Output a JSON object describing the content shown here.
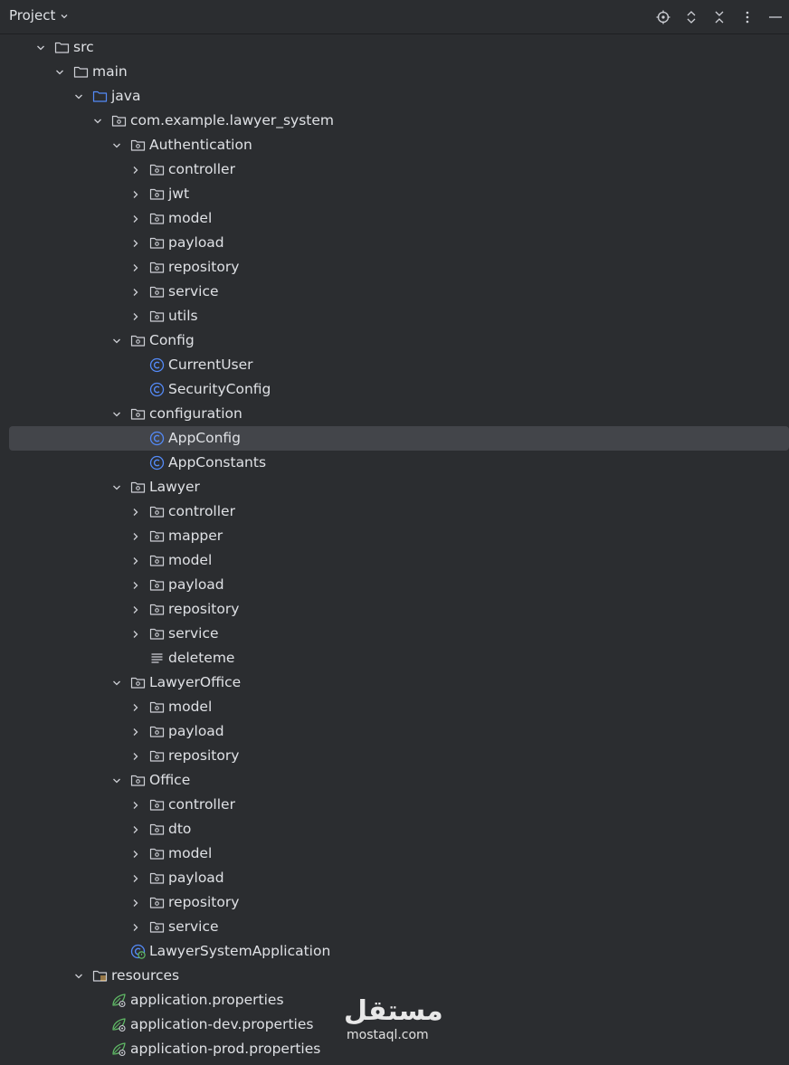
{
  "panel": {
    "title": "Project",
    "actions": [
      {
        "icon": "locate-icon"
      },
      {
        "icon": "expand-all-icon"
      },
      {
        "icon": "collapse-all-icon"
      },
      {
        "icon": "more-options-icon"
      },
      {
        "icon": "hide-panel-icon"
      }
    ]
  },
  "tree": [
    {
      "label": "src",
      "depth": 0,
      "expanded": true,
      "kind": "folder"
    },
    {
      "label": "main",
      "depth": 1,
      "expanded": true,
      "kind": "folder"
    },
    {
      "label": "java",
      "depth": 2,
      "expanded": true,
      "kind": "source-root"
    },
    {
      "label": "com.example.lawyer_system",
      "depth": 3,
      "expanded": true,
      "kind": "package"
    },
    {
      "label": "Authentication",
      "depth": 4,
      "expanded": true,
      "kind": "package"
    },
    {
      "label": "controller",
      "depth": 5,
      "expanded": false,
      "kind": "package"
    },
    {
      "label": "jwt",
      "depth": 5,
      "expanded": false,
      "kind": "package"
    },
    {
      "label": "model",
      "depth": 5,
      "expanded": false,
      "kind": "package"
    },
    {
      "label": "payload",
      "depth": 5,
      "expanded": false,
      "kind": "package"
    },
    {
      "label": "repository",
      "depth": 5,
      "expanded": false,
      "kind": "package"
    },
    {
      "label": "service",
      "depth": 5,
      "expanded": false,
      "kind": "package"
    },
    {
      "label": "utils",
      "depth": 5,
      "expanded": false,
      "kind": "package"
    },
    {
      "label": "Config",
      "depth": 4,
      "expanded": true,
      "kind": "package"
    },
    {
      "label": "CurrentUser",
      "depth": 5,
      "kind": "class"
    },
    {
      "label": "SecurityConfig",
      "depth": 5,
      "kind": "class"
    },
    {
      "label": "configuration",
      "depth": 4,
      "expanded": true,
      "kind": "package"
    },
    {
      "label": "AppConfig",
      "depth": 5,
      "kind": "class",
      "selected": true
    },
    {
      "label": "AppConstants",
      "depth": 5,
      "kind": "class"
    },
    {
      "label": "Lawyer",
      "depth": 4,
      "expanded": true,
      "kind": "package"
    },
    {
      "label": "controller",
      "depth": 5,
      "expanded": false,
      "kind": "package"
    },
    {
      "label": "mapper",
      "depth": 5,
      "expanded": false,
      "kind": "package"
    },
    {
      "label": "model",
      "depth": 5,
      "expanded": false,
      "kind": "package"
    },
    {
      "label": "payload",
      "depth": 5,
      "expanded": false,
      "kind": "package"
    },
    {
      "label": "repository",
      "depth": 5,
      "expanded": false,
      "kind": "package"
    },
    {
      "label": "service",
      "depth": 5,
      "expanded": false,
      "kind": "package"
    },
    {
      "label": "deleteme",
      "depth": 5,
      "kind": "text-file"
    },
    {
      "label": "LawyerOffice",
      "depth": 4,
      "expanded": true,
      "kind": "package"
    },
    {
      "label": "model",
      "depth": 5,
      "expanded": false,
      "kind": "package"
    },
    {
      "label": "payload",
      "depth": 5,
      "expanded": false,
      "kind": "package"
    },
    {
      "label": "repository",
      "depth": 5,
      "expanded": false,
      "kind": "package"
    },
    {
      "label": "Office",
      "depth": 4,
      "expanded": true,
      "kind": "package"
    },
    {
      "label": "controller",
      "depth": 5,
      "expanded": false,
      "kind": "package"
    },
    {
      "label": "dto",
      "depth": 5,
      "expanded": false,
      "kind": "package"
    },
    {
      "label": "model",
      "depth": 5,
      "expanded": false,
      "kind": "package"
    },
    {
      "label": "payload",
      "depth": 5,
      "expanded": false,
      "kind": "package"
    },
    {
      "label": "repository",
      "depth": 5,
      "expanded": false,
      "kind": "package"
    },
    {
      "label": "service",
      "depth": 5,
      "expanded": false,
      "kind": "package"
    },
    {
      "label": "LawyerSystemApplication",
      "depth": 4,
      "kind": "spring-app"
    },
    {
      "label": "resources",
      "depth": 2,
      "expanded": true,
      "kind": "resources-root"
    },
    {
      "label": "application.properties",
      "depth": 3,
      "kind": "spring-properties"
    },
    {
      "label": "application-dev.properties",
      "depth": 3,
      "kind": "spring-properties"
    },
    {
      "label": "application-prod.properties",
      "depth": 3,
      "kind": "spring-properties"
    }
  ],
  "watermark": {
    "arabic": "مستقل",
    "latin": "mostaql.com"
  },
  "colors": {
    "background": "#2b2d30",
    "text": "#dfe1e5",
    "icon": "#ced0d6",
    "selection": "#43454a",
    "source_root": "#548af7",
    "class_icon": "#548af7",
    "spring_green": "#5fb865"
  }
}
